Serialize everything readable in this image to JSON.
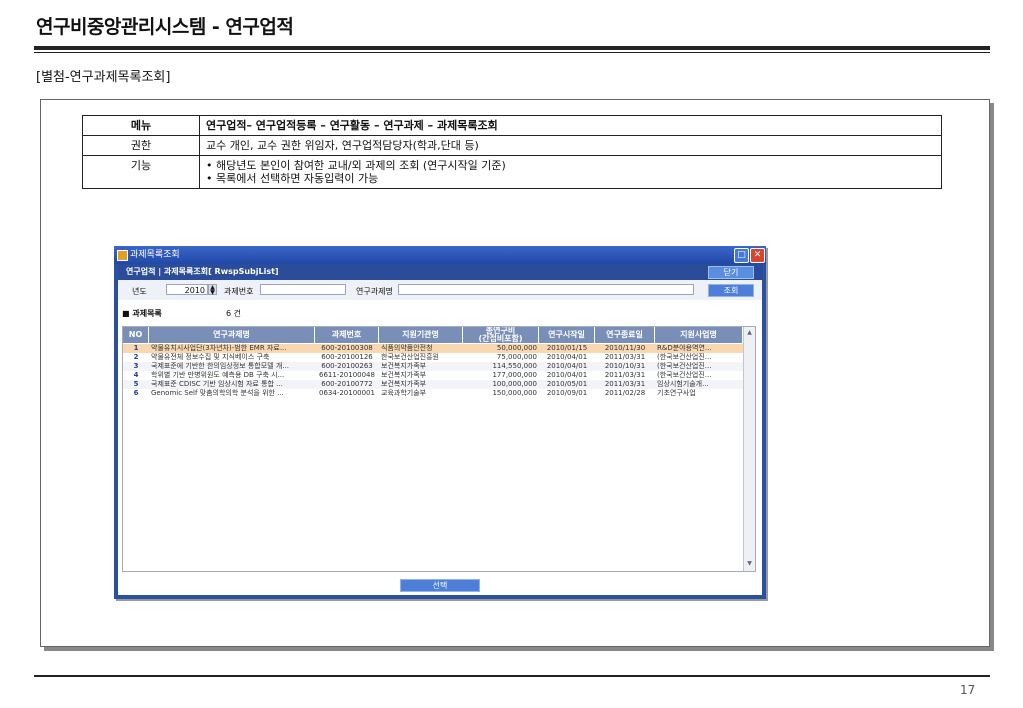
{
  "doc": {
    "title": "연구비중앙관리시스템 - 연구업적",
    "subtitle": "[별첨-연구과제목록조회]",
    "page_number": "17"
  },
  "info_table": {
    "rows": [
      {
        "key": "메뉴",
        "value": "연구업적– 연구업적등록 – 연구활동 – 연구과제 – 과제목록조회"
      },
      {
        "key": "권한",
        "value": "교수 개인, 교수 권한 위임자, 연구업적담당자(학과,단대 등)"
      },
      {
        "key": "기능",
        "value": "• 해당년도 본인이 참여한 교내/외 과제의 조회 (연구시작일 기준)",
        "value2": "• 목록에서 선택하면 자동입력이 가능"
      }
    ]
  },
  "window": {
    "title": "과제목록조회",
    "path": "연구업적   |  과제목록조회[ RwspSubjList]",
    "close_label": "닫기",
    "search": {
      "year_label": "년도",
      "year_value": "2010",
      "subj_no_label": "과제번호",
      "subj_no_value": "",
      "subj_name_label": "연구과제명",
      "subj_name_value": "",
      "search_label": "조회"
    },
    "list_title": "■ 과제목록",
    "list_count": "6  건",
    "columns": [
      "NO",
      "연구과제명",
      "과제번호",
      "지원기관명",
      "총연구비\n(간접비포함)",
      "연구시작일",
      "연구종료일",
      "지원사업명"
    ],
    "rows": [
      {
        "no": "1",
        "name": "약물유치시사업단(3차년차)-범한 EMR 자료...",
        "code": "600-20100308",
        "agency": "식품의약품안전청",
        "amount": "50,000,000",
        "start": "2010/01/15",
        "end": "2010/11/30",
        "program": "R&D분야용역연..."
      },
      {
        "no": "2",
        "name": "약물유전체 정보수집 및 지식베이스 구축",
        "code": "600-20100126",
        "agency": "한국보건산업진흥원",
        "amount": "75,000,000",
        "start": "2010/04/01",
        "end": "2011/03/31",
        "program": "(한국보건산업진..."
      },
      {
        "no": "3",
        "name": "국제표준에 기반한 한의임상정보 통합모델 개...",
        "code": "600-20100263",
        "agency": "보건복지가족부",
        "amount": "114,550,000",
        "start": "2010/04/01",
        "end": "2010/10/31",
        "program": "(한국보건산업진..."
      },
      {
        "no": "4",
        "name": "학위별 기반 만병위원도 예측용 DB 구축 시...",
        "code": "6611-20100048",
        "agency": "보건복지가족부",
        "amount": "177,000,000",
        "start": "2010/04/01",
        "end": "2011/03/31",
        "program": "(한국보건산업진..."
      },
      {
        "no": "5",
        "name": "국제표준 CDISC 기반 임상시험 자료 통합 ...",
        "code": "600-20100772",
        "agency": "보건복지가족부",
        "amount": "100,000,000",
        "start": "2010/05/01",
        "end": "2011/03/31",
        "program": "임상시험기술개..."
      },
      {
        "no": "6",
        "name": "Genomic Self 맞춤의학의학 분석을 위한 ...",
        "code": "0634-20100001",
        "agency": "교육과학기술부",
        "amount": "150,000,000",
        "start": "2010/09/01",
        "end": "2011/02/28",
        "program": "기초연구사업"
      }
    ],
    "select_label": "선택"
  },
  "colors": {
    "window_blue": "#2b4fa3",
    "grid_header": "#7a8fb8",
    "selected_row": "#f7d8b0"
  }
}
